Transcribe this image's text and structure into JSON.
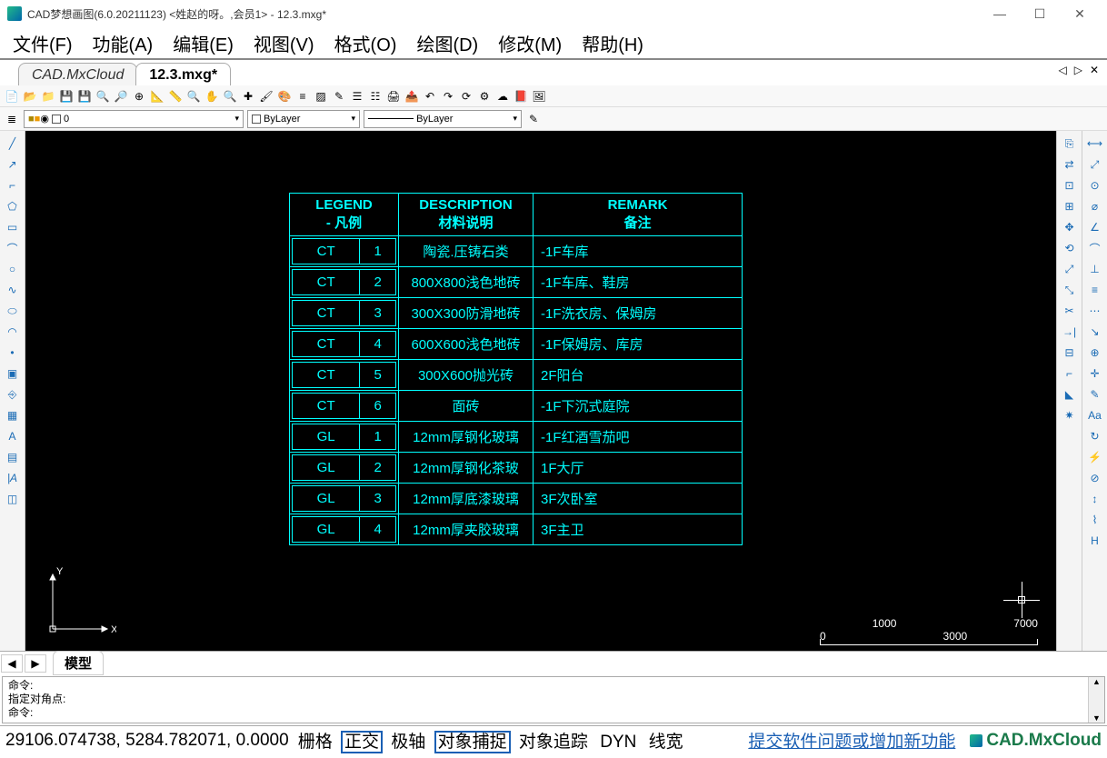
{
  "window": {
    "title": "CAD梦想画图(6.0.20211123) <姓赵的呀。,会员1> - 12.3.mxg*"
  },
  "menu": [
    "文件(F)",
    "功能(A)",
    "编辑(E)",
    "视图(V)",
    "格式(O)",
    "绘图(D)",
    "修改(M)",
    "帮助(H)"
  ],
  "file_tabs": {
    "inactive": "CAD.MxCloud",
    "active": "12.3.mxg*"
  },
  "layer": {
    "name": "0",
    "color": "ByLayer",
    "linetype": "ByLayer"
  },
  "legend": {
    "headers": {
      "col1_en": "LEGEND",
      "col1_cn": "- 凡例",
      "col2_en": "DESCRIPTION",
      "col2_cn": "材料说明",
      "col3_en": "REMARK",
      "col3_cn": "备注"
    },
    "rows": [
      {
        "code": "CT",
        "num": "1",
        "desc": "陶瓷.压铸石类",
        "remark": "-1F车库"
      },
      {
        "code": "CT",
        "num": "2",
        "desc": "800X800浅色地砖",
        "remark": "-1F车库、鞋房"
      },
      {
        "code": "CT",
        "num": "3",
        "desc": "300X300防滑地砖",
        "remark": "-1F洗衣房、保姆房"
      },
      {
        "code": "CT",
        "num": "4",
        "desc": "600X600浅色地砖",
        "remark": "-1F保姆房、库房"
      },
      {
        "code": "CT",
        "num": "5",
        "desc": "300X600抛光砖",
        "remark": "2F阳台"
      },
      {
        "code": "CT",
        "num": "6",
        "desc": "面砖",
        "remark": "-1F下沉式庭院"
      },
      {
        "code": "GL",
        "num": "1",
        "desc": "12mm厚钢化玻璃",
        "remark": "-1F红酒雪茄吧"
      },
      {
        "code": "GL",
        "num": "2",
        "desc": "12mm厚钢化茶玻",
        "remark": "1F大厅"
      },
      {
        "code": "GL",
        "num": "3",
        "desc": "12mm厚底漆玻璃",
        "remark": "3F次卧室"
      },
      {
        "code": "GL",
        "num": "4",
        "desc": "12mm厚夹胶玻璃",
        "remark": "3F主卫"
      }
    ]
  },
  "scale": {
    "t0": "0",
    "t1": "1000",
    "t2": "3000",
    "t3": "7000"
  },
  "ucs": {
    "x": "X",
    "y": "Y"
  },
  "bottom_tab": "模型",
  "command": {
    "line1": "命令:",
    "line2": "指定对角点:",
    "line3": "命令:"
  },
  "status": {
    "coord": "29106.074738, 5284.782071, 0.0000",
    "buttons": [
      "栅格",
      "正交",
      "极轴",
      "对象捕捉",
      "对象追踪",
      "DYN",
      "线宽"
    ],
    "framed": [
      1,
      3
    ],
    "link": "提交软件问题或增加新功能",
    "brand": "CAD.MxCloud"
  }
}
